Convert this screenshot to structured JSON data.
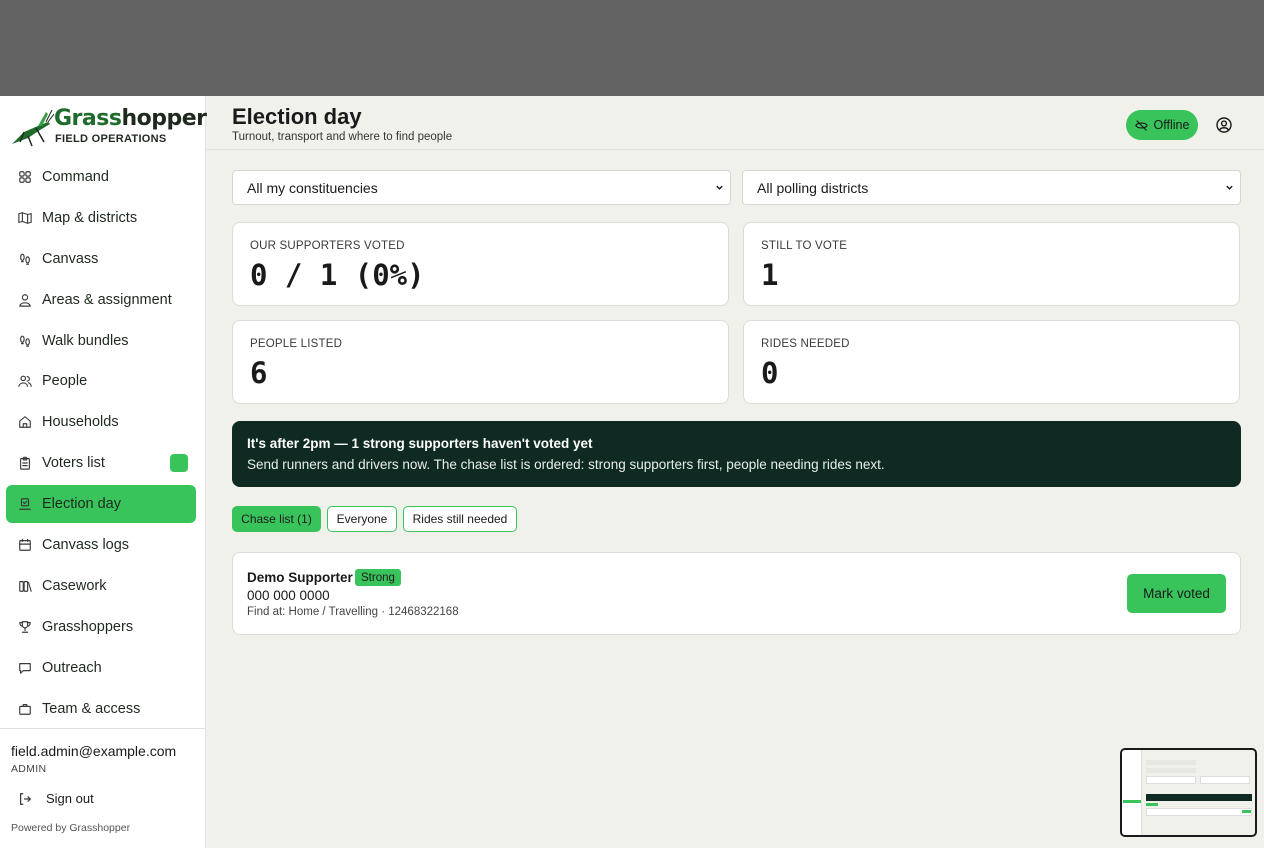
{
  "brand": {
    "name_part1": "Grass",
    "name_part2": "hopper",
    "tagline": "FIELD OPERATIONS"
  },
  "nav": [
    {
      "label": "Command",
      "icon": "grid-icon",
      "active": false
    },
    {
      "label": "Map & districts",
      "icon": "map-icon",
      "active": false
    },
    {
      "label": "Canvass",
      "icon": "footprints-icon",
      "active": false
    },
    {
      "label": "Areas & assignment",
      "icon": "user-pin-icon",
      "active": false
    },
    {
      "label": "Walk bundles",
      "icon": "footprints-icon",
      "active": false
    },
    {
      "label": "People",
      "icon": "users-icon",
      "active": false
    },
    {
      "label": "Households",
      "icon": "home-icon",
      "active": false
    },
    {
      "label": "Voters list",
      "icon": "clipboard-icon",
      "active": false,
      "badge": true
    },
    {
      "label": "Election day",
      "icon": "vote-icon",
      "active": true
    },
    {
      "label": "Canvass logs",
      "icon": "calendar-icon",
      "active": false
    },
    {
      "label": "Casework",
      "icon": "folders-icon",
      "active": false
    },
    {
      "label": "Grasshoppers",
      "icon": "trophy-icon",
      "active": false
    },
    {
      "label": "Outreach",
      "icon": "message-icon",
      "active": false
    },
    {
      "label": "Team & access",
      "icon": "briefcase-icon",
      "active": false
    }
  ],
  "user": {
    "email": "field.admin@example.com",
    "role": "ADMIN",
    "signout_label": "Sign out"
  },
  "footer": {
    "powered": "Powered by Grasshopper"
  },
  "header": {
    "title": "Election day",
    "subtitle": "Turnout, transport and where to find people",
    "offline_label": "Offline"
  },
  "filters": {
    "constituency": "All my constituencies",
    "district": "All polling districts"
  },
  "stats": [
    {
      "label": "OUR SUPPORTERS VOTED",
      "value": "0 / 1 (0%)"
    },
    {
      "label": "STILL TO VOTE",
      "value": "1"
    },
    {
      "label": "PEOPLE LISTED",
      "value": "6"
    },
    {
      "label": "RIDES NEEDED",
      "value": "0"
    }
  ],
  "alert": {
    "title": "It's after 2pm — 1 strong supporters haven't voted yet",
    "body": "Send runners and drivers now. The chase list is ordered: strong supporters first, people needing rides next."
  },
  "tabs": [
    {
      "label": "Chase list (1)",
      "active": true
    },
    {
      "label": "Everyone",
      "active": false
    },
    {
      "label": "Rides still needed",
      "active": false
    }
  ],
  "people": [
    {
      "name": "Demo Supporter",
      "strength": "Strong",
      "phone": "000 000 0000",
      "location": "Find at: Home / Travelling · 12468322168",
      "action_label": "Mark voted"
    }
  ],
  "colors": {
    "accent": "#39c45b",
    "alert_bg": "#0f2a22",
    "page_bg": "#f1f1ec",
    "backdrop": "#636363"
  }
}
